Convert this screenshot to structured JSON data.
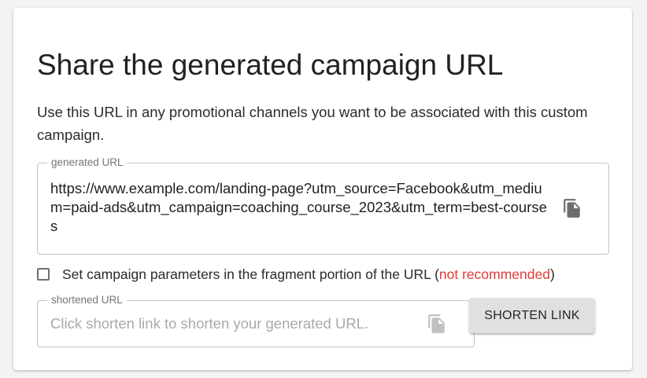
{
  "card": {
    "title": "Share the generated campaign URL",
    "description": "Use this URL in any promotional channels you want to be associated with this custom campaign."
  },
  "generated_url": {
    "label": "generated URL",
    "value": "https://www.example.com/landing-page?utm_source=Facebook&utm_medium=paid-ads&utm_campaign=coaching_course_2023&utm_term=best-courses",
    "copy_icon": "copy-icon"
  },
  "fragment_option": {
    "label": "Set campaign parameters in the fragment portion of the URL (",
    "warning": "not recommended",
    "label_end": ")",
    "checked": false,
    "warning_color": "#e53935"
  },
  "shortened_url": {
    "label": "shortened URL",
    "placeholder": "Click shorten link to shorten your generated URL.",
    "copy_icon": "copy-icon"
  },
  "shorten_button": {
    "label": "SHORTEN LINK"
  }
}
